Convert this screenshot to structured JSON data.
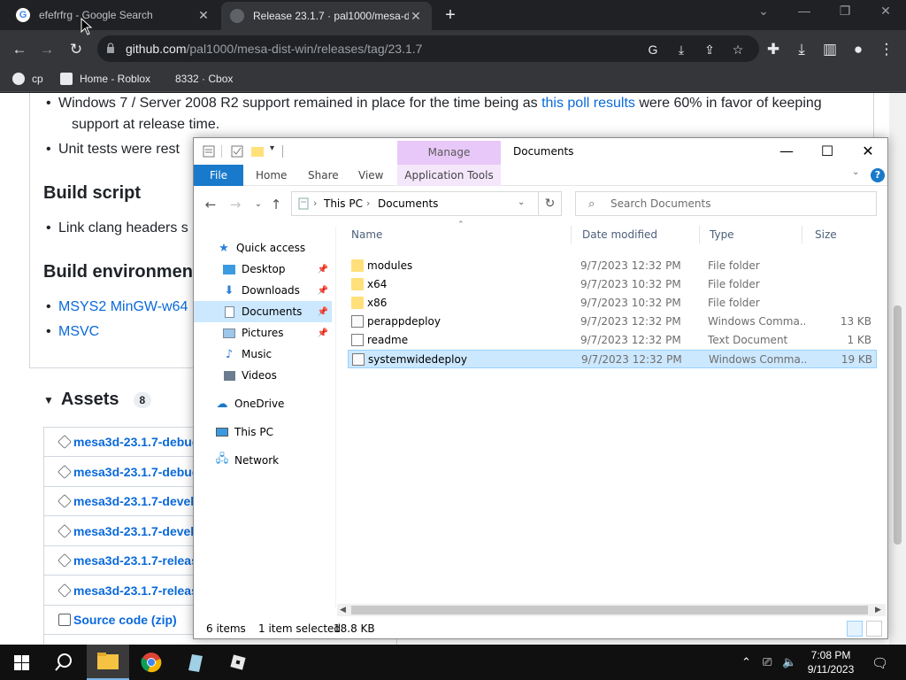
{
  "browser": {
    "tabs": [
      {
        "title": "efefrfrg - Google Search",
        "favicon": "G"
      },
      {
        "title": "Release 23.1.7 · pal1000/mesa-dis",
        "favicon": ""
      }
    ],
    "new_tab": "+",
    "url_host": "github.com",
    "url_path": "/pal1000/mesa-dist-win/releases/tag/23.1.7",
    "bookmarks": [
      {
        "label": "cp"
      },
      {
        "label": "Home - Roblox"
      },
      {
        "label": "8332 · Cbox"
      }
    ]
  },
  "page": {
    "bullets_top": [
      {
        "pre": "Windows 7 / Server 2008 R2 support remained in place for the time being as ",
        "link": "this poll results",
        "post": " were 60% in favor of keeping"
      },
      {
        "text": "support at release time."
      },
      {
        "text": "Unit tests were rest"
      }
    ],
    "build_script_heading": "Build script",
    "build_script_item": "Link clang headers s",
    "build_env_heading": "Build environment",
    "build_env_items": [
      "MSYS2 MinGW-w64",
      "MSVC"
    ],
    "assets_heading": "Assets",
    "assets_count": "8",
    "assets": [
      "mesa3d-23.1.7-debug",
      "mesa3d-23.1.7-debug",
      "mesa3d-23.1.7-develo",
      "mesa3d-23.1.7-develo",
      "mesa3d-23.1.7-release",
      "mesa3d-23.1.7-release",
      "Source code (zip)"
    ]
  },
  "explorer": {
    "title": "Documents",
    "manage_label": "Manage",
    "ribbon_tabs": [
      "File",
      "Home",
      "Share",
      "View",
      "Application Tools"
    ],
    "breadcrumb": [
      "This PC",
      "Documents"
    ],
    "search_placeholder": "Search Documents",
    "nav": {
      "quick_access": "Quick access",
      "desktop": "Desktop",
      "downloads": "Downloads",
      "documents": "Documents",
      "pictures": "Pictures",
      "music": "Music",
      "videos": "Videos",
      "onedrive": "OneDrive",
      "this_pc": "This PC",
      "network": "Network"
    },
    "columns": {
      "name": "Name",
      "date": "Date modified",
      "type": "Type",
      "size": "Size"
    },
    "files": [
      {
        "name": "modules",
        "date": "9/7/2023 12:32 PM",
        "type": "File folder",
        "size": "",
        "icon": "folder-icon"
      },
      {
        "name": "x64",
        "date": "9/7/2023 10:32 PM",
        "type": "File folder",
        "size": "",
        "icon": "folder-icon"
      },
      {
        "name": "x86",
        "date": "9/7/2023 10:32 PM",
        "type": "File folder",
        "size": "",
        "icon": "folder-icon"
      },
      {
        "name": "perappdeploy",
        "date": "9/7/2023 12:32 PM",
        "type": "Windows Comma...",
        "size": "13 KB",
        "icon": "cmd-file-icon"
      },
      {
        "name": "readme",
        "date": "9/7/2023 12:32 PM",
        "type": "Text Document",
        "size": "1 KB",
        "icon": "text-file-icon"
      },
      {
        "name": "systemwidedeploy",
        "date": "9/7/2023 12:32 PM",
        "type": "Windows Comma...",
        "size": "19 KB",
        "icon": "cmd-file-icon",
        "selected": true
      }
    ],
    "status": {
      "items": "6 items",
      "selected": "1 item selected",
      "size": "18.8 KB"
    }
  },
  "taskbar": {
    "time": "7:08 PM",
    "date": "9/11/2023"
  },
  "colors": {
    "chrome_dark": "#202124",
    "chrome_toolbar": "#35363a",
    "github_link": "#0969da",
    "explorer_select": "#cce8ff",
    "file_tab_blue": "#1979ca",
    "manage_purple": "#e8c8f8"
  }
}
